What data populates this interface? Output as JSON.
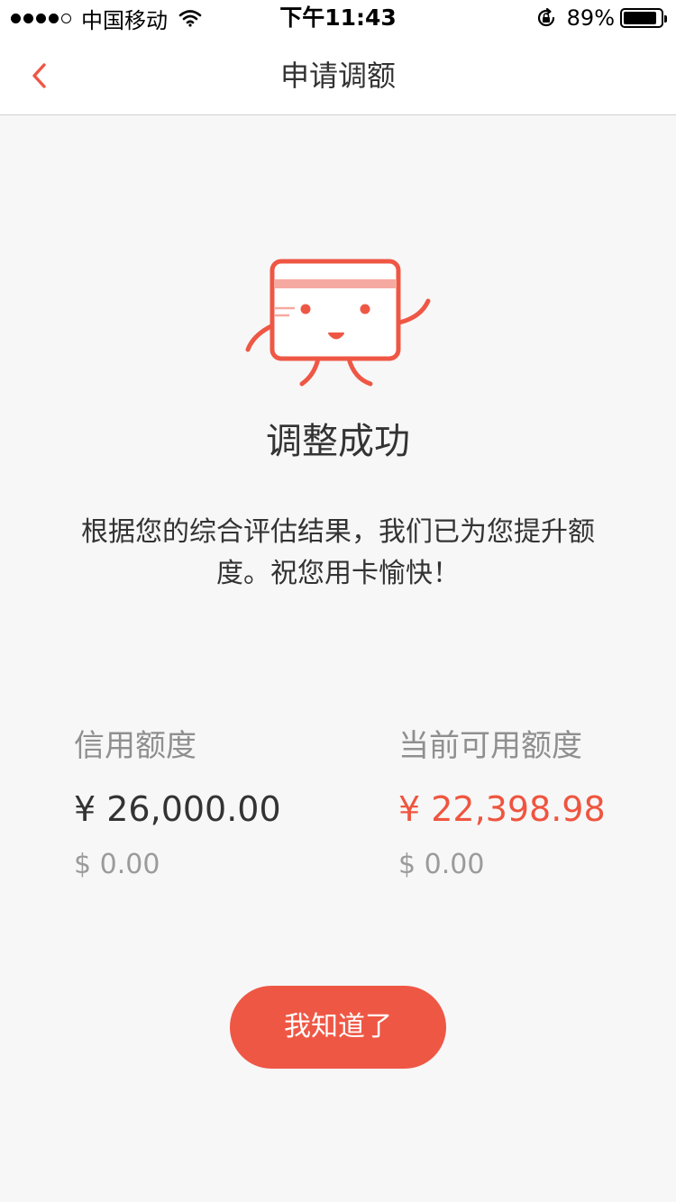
{
  "status_bar": {
    "carrier": "中国移动",
    "time": "下午11:43",
    "battery_percent": "89%",
    "battery_level": 0.89,
    "signal_bars_filled": 4,
    "signal_bars_total": 5
  },
  "nav": {
    "title": "申请调额",
    "back_icon": "chevron-left-icon"
  },
  "result": {
    "mascot_icon": "card-mascot-icon",
    "title": "调整成功",
    "description": "根据您的综合评估结果，我们已为您提升额度。祝您用卡愉快！"
  },
  "limits": {
    "credit": {
      "label": "信用额度",
      "rmb": "¥ 26,000.00",
      "usd": "$ 0.00"
    },
    "available": {
      "label": "当前可用额度",
      "rmb": "¥ 22,398.98",
      "usd": "$ 0.00"
    }
  },
  "actions": {
    "confirm_label": "我知道了"
  },
  "colors": {
    "accent": "#ef5745",
    "available_amount": "#ef553f",
    "background": "#f7f7f7"
  }
}
